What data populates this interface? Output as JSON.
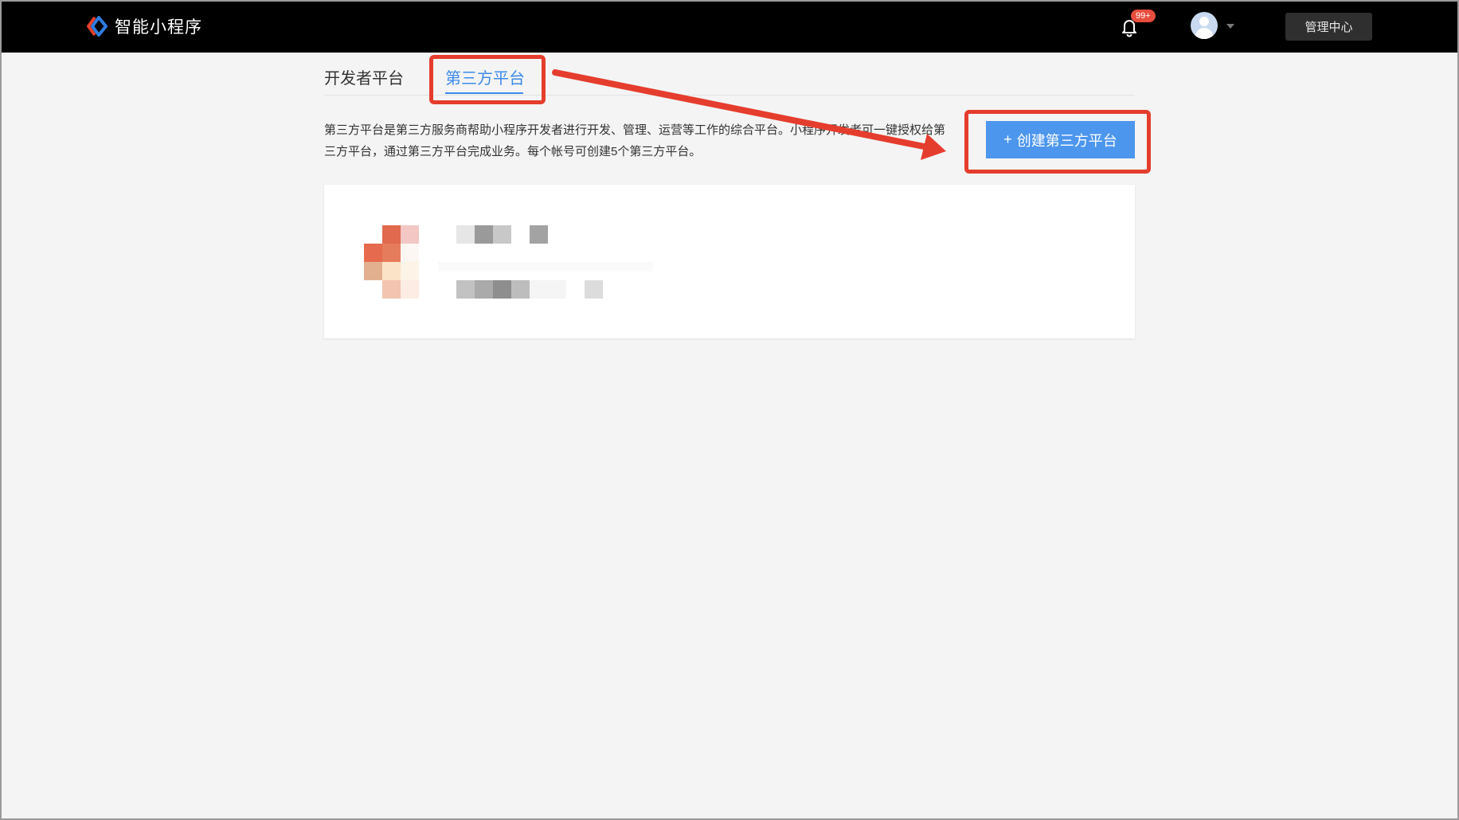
{
  "header": {
    "app_name": "智能小程序",
    "notification_badge": "99+",
    "admin_button": "管理中心"
  },
  "tabs": [
    {
      "label": "开发者平台",
      "active": false
    },
    {
      "label": "第三方平台",
      "active": true
    }
  ],
  "description": "第三方平台是第三方服务商帮助小程序开发者进行开发、管理、运营等工作的综合平台。小程序开发者可一键授权给第三方平台，通过第三方平台完成业务。每个帐号可创建5个第三方平台。",
  "create_button": {
    "label": "创建第三方平台",
    "icon": "plus-icon"
  },
  "colors": {
    "accent": "#3c8bea",
    "button": "#4c96ee",
    "highlight": "#e53d2d",
    "topbar": "#000000"
  }
}
